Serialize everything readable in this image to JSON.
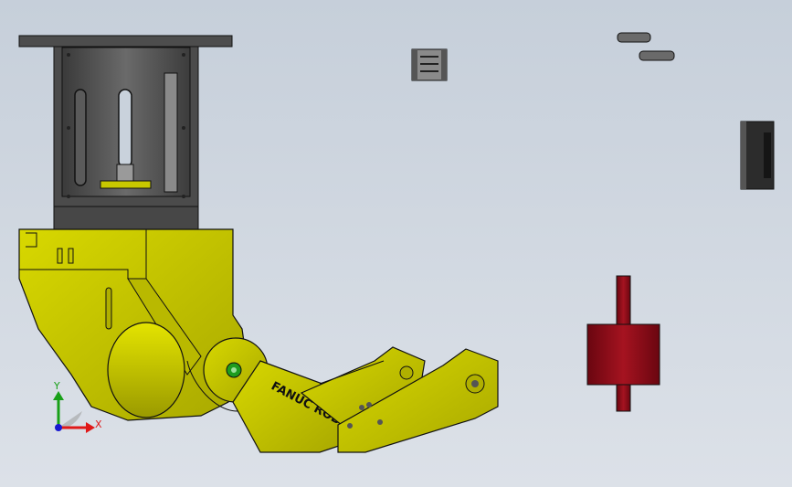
{
  "viewport": {
    "background_top": "#c6cfda",
    "background_bottom": "#dce1e8"
  },
  "model": {
    "engraving_text": "FANUC ROBO",
    "body_color": "#c8c800",
    "body_shadow_color": "#8d8d00",
    "housing_color": "#4a4a4a",
    "bushing_color": "#8c0a14",
    "joint_marker_color": "#1e9c1e"
  },
  "parts": {
    "coupling_label": "",
    "washers_label": "",
    "pulley_label": "",
    "bushing_label": ""
  },
  "triad": {
    "x_label": "X",
    "y_label": "Y",
    "x_color": "#e01818",
    "y_color": "#18a018",
    "z_color": "#1818d0"
  }
}
